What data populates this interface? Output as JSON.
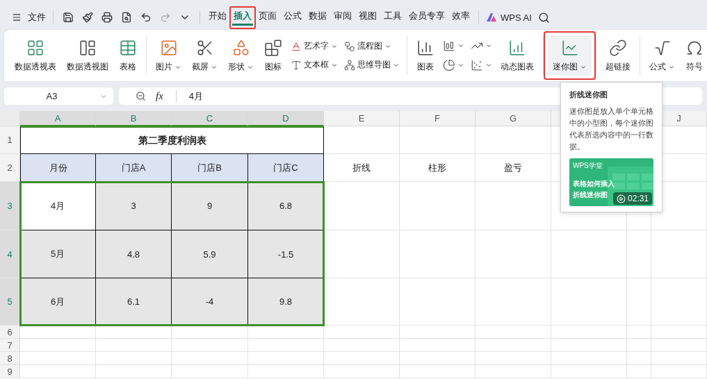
{
  "menu": {
    "file_label": "文件",
    "tabs": [
      {
        "label": "开始",
        "selected": false,
        "highlighted": false
      },
      {
        "label": "插入",
        "selected": true,
        "highlighted": true
      },
      {
        "label": "页面",
        "selected": false,
        "highlighted": false
      },
      {
        "label": "公式",
        "selected": false,
        "highlighted": false
      },
      {
        "label": "数据",
        "selected": false,
        "highlighted": false
      },
      {
        "label": "审阅",
        "selected": false,
        "highlighted": false
      },
      {
        "label": "视图",
        "selected": false,
        "highlighted": false
      },
      {
        "label": "工具",
        "selected": false,
        "highlighted": false
      },
      {
        "label": "会员专享",
        "selected": false,
        "highlighted": false
      },
      {
        "label": "效率",
        "selected": false,
        "highlighted": false
      }
    ],
    "ai_label": "WPS AI"
  },
  "ribbon": {
    "groups": [
      {
        "items": [
          {
            "kind": "large",
            "label": "数据透视表",
            "dropdown": false,
            "highlighted": false
          },
          {
            "kind": "large",
            "label": "数据透视图",
            "dropdown": false,
            "highlighted": false
          },
          {
            "kind": "large",
            "label": "表格",
            "dropdown": false,
            "highlighted": false
          }
        ]
      },
      {
        "items": [
          {
            "kind": "large",
            "label": "图片",
            "dropdown": true,
            "highlighted": false
          },
          {
            "kind": "large",
            "label": "截屏",
            "dropdown": true,
            "highlighted": false
          },
          {
            "kind": "large",
            "label": "形状",
            "dropdown": true,
            "highlighted": false
          },
          {
            "kind": "large",
            "label": "图标",
            "dropdown": false,
            "highlighted": false
          },
          {
            "kind": "stack",
            "rows": [
              {
                "label": "艺术字",
                "dropdown": true
              },
              {
                "label": "文本框",
                "dropdown": true
              }
            ]
          },
          {
            "kind": "stack",
            "rows": [
              {
                "label": "流程图",
                "dropdown": true
              },
              {
                "label": "思维导图",
                "dropdown": true
              }
            ]
          }
        ]
      },
      {
        "items": [
          {
            "kind": "large",
            "label": "图表",
            "dropdown": false,
            "highlighted": false
          },
          {
            "kind": "iconstack",
            "rows": [
              {
                "dropdown": true
              },
              {
                "dropdown": true
              }
            ]
          },
          {
            "kind": "iconstack",
            "rows": [
              {
                "dropdown": true
              },
              {
                "dropdown": true
              }
            ]
          },
          {
            "kind": "large",
            "label": "动态图表",
            "dropdown": false,
            "highlighted": false
          }
        ]
      },
      {
        "items": [
          {
            "kind": "large",
            "label": "迷你图",
            "dropdown": true,
            "highlighted": true
          }
        ]
      },
      {
        "items": [
          {
            "kind": "large",
            "label": "超链接",
            "dropdown": false,
            "highlighted": false
          }
        ]
      },
      {
        "items": [
          {
            "kind": "large",
            "label": "公式",
            "dropdown": true,
            "highlighted": false
          },
          {
            "kind": "large",
            "label": "符号",
            "dropdown": false,
            "highlighted": false
          }
        ]
      }
    ]
  },
  "formula_bar": {
    "cell_name": "A3",
    "function_label": "fx",
    "formula": "4月"
  },
  "sheet": {
    "columns": [
      {
        "kind": "header",
        "label": "A",
        "selected": true
      },
      {
        "kind": "header",
        "label": "B",
        "selected": true
      },
      {
        "kind": "header",
        "label": "C",
        "selected": true
      },
      {
        "kind": "header",
        "label": "D",
        "selected": true
      },
      {
        "kind": "header",
        "label": "E",
        "selected": false
      },
      {
        "kind": "header",
        "label": "F",
        "selected": false
      },
      {
        "kind": "header",
        "label": "G",
        "selected": false
      },
      {
        "kind": "partly_covered"
      },
      {
        "kind": "covered"
      },
      {
        "kind": "header",
        "label": "J",
        "selected": false
      }
    ],
    "rows": [
      {
        "header": "1",
        "kind": "title",
        "selected": false,
        "title": "第二季度利润表"
      },
      {
        "header": "2",
        "kind": "heading",
        "selected": false,
        "cells": [
          "月份",
          "门店A",
          "门店B",
          "门店C"
        ],
        "extras": [
          "折线",
          "柱形",
          "盈亏"
        ]
      },
      {
        "header": "3",
        "kind": "data",
        "selected": true,
        "cells": [
          {
            "text": "4月",
            "active": true
          },
          {
            "text": "3",
            "active": false
          },
          {
            "text": "9",
            "active": false
          },
          {
            "text": "6.8",
            "active": false
          }
        ]
      },
      {
        "header": "4",
        "kind": "data",
        "selected": true,
        "cells": [
          {
            "text": "5月",
            "active": false
          },
          {
            "text": "4.8",
            "active": false
          },
          {
            "text": "5.9",
            "active": false
          },
          {
            "text": "-1.5",
            "active": false
          }
        ]
      },
      {
        "header": "5",
        "kind": "data",
        "selected": true,
        "cells": [
          {
            "text": "6月",
            "active": false
          },
          {
            "text": "6.1",
            "active": false
          },
          {
            "text": "-4",
            "active": false
          },
          {
            "text": "9.8",
            "active": false
          }
        ]
      },
      {
        "header": "6",
        "kind": "empty",
        "selected": false
      },
      {
        "header": "7",
        "kind": "empty",
        "selected": false
      },
      {
        "header": "8",
        "kind": "empty",
        "selected": false
      },
      {
        "header": "9",
        "kind": "empty",
        "selected": false
      }
    ]
  },
  "tooltip": {
    "title": "折线迷你图",
    "body": "迷你图是放入单个单元格中的小型图，每个迷你图代表所选内容中的一行数据。",
    "video": {
      "brand": "WPS学堂",
      "title_lines": [
        "表格如何插入",
        "折线迷你图"
      ],
      "duration": "02:31"
    }
  }
}
